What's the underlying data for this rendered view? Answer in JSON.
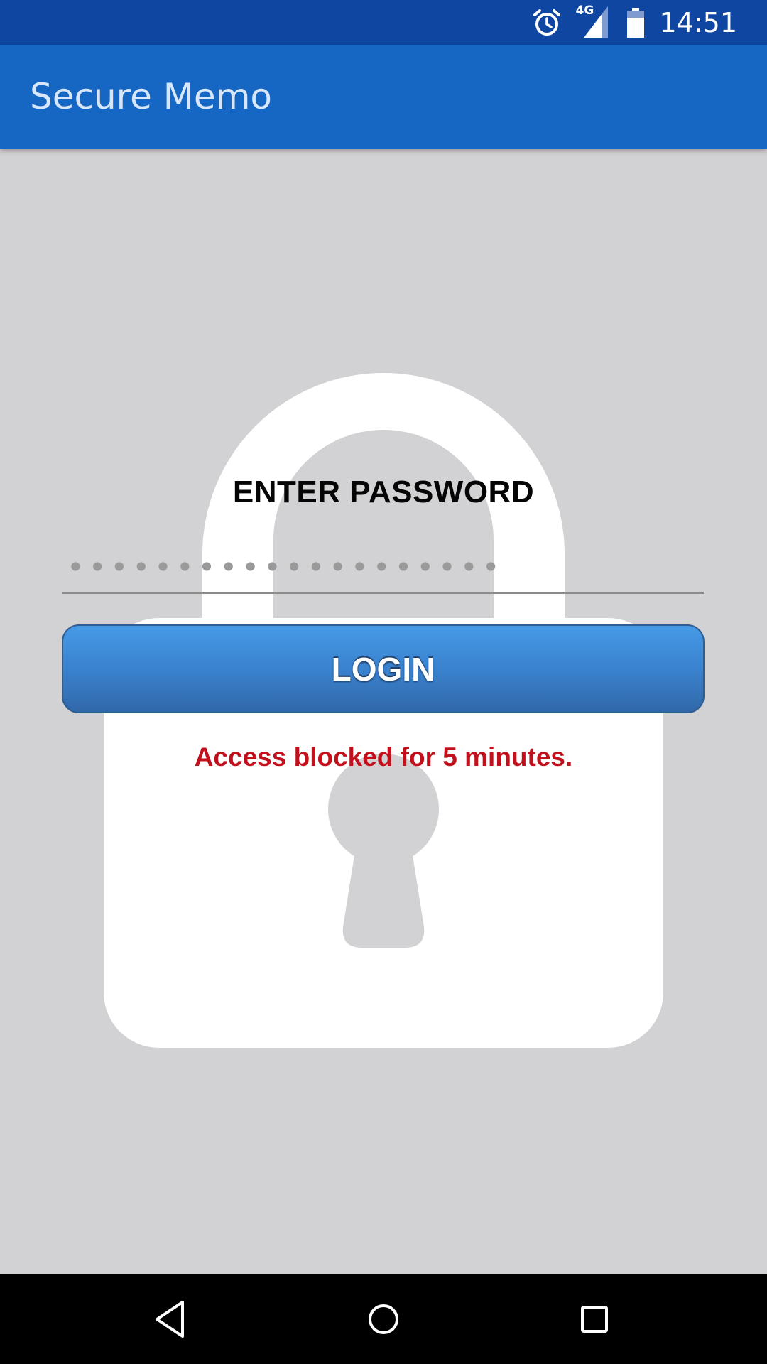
{
  "status_bar": {
    "time": "14:51",
    "network_label": "4G",
    "icons": [
      "alarm-icon",
      "signal-icon",
      "battery-icon"
    ],
    "background_color": "#0f46a1"
  },
  "app_bar": {
    "title": "Secure Memo",
    "background_color": "#1666c4"
  },
  "login_form": {
    "heading": "ENTER PASSWORD",
    "password_value": "••••••••••••••••••••",
    "login_button_label": "LOGIN",
    "error_message": "Access blocked for 5 minutes.",
    "background_icon": "padlock-icon",
    "button_color": "#3a82cf",
    "error_color": "#c2111c"
  },
  "nav_bar": {
    "icons": [
      "back-icon",
      "home-icon",
      "recents-icon"
    ]
  }
}
